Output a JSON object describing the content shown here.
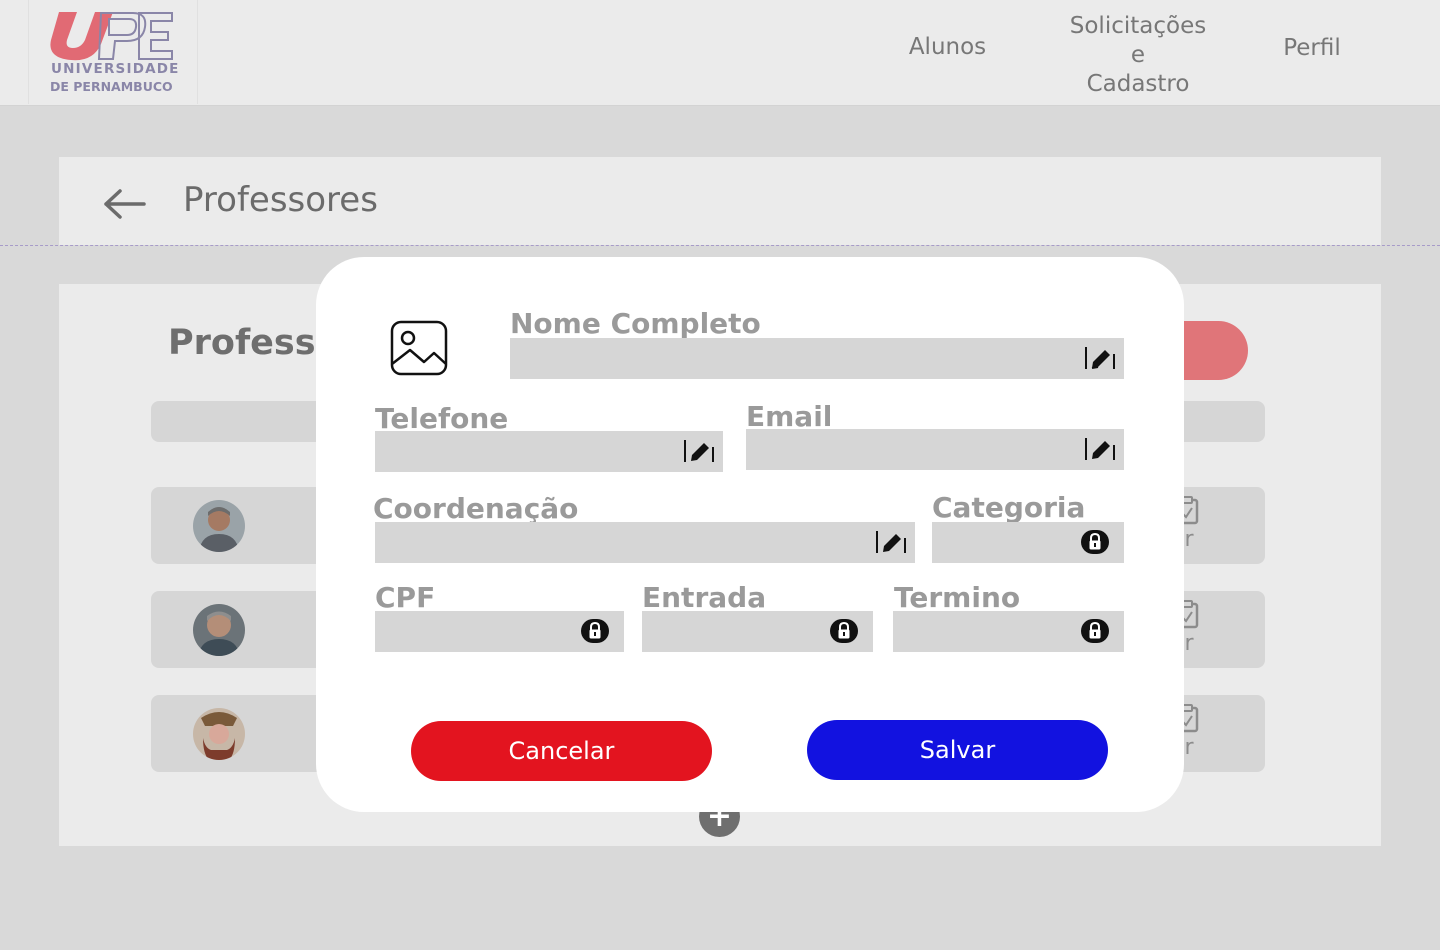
{
  "header": {
    "logo": {
      "mark": "UPE",
      "line1": "UNIVERSIDADE",
      "line2": "DE PERNAMBUCO"
    },
    "nav": {
      "alunos": "Alunos",
      "solicitacoes_line1": "Solicitações",
      "solicitacoes_line2": "e",
      "solicitacoes_line3": "Cadastro",
      "perfil": "Perfil"
    }
  },
  "breadcrumb": {
    "title": "Professores",
    "back_icon": "arrow-left-icon"
  },
  "background": {
    "heading": "Professo",
    "rows": [
      {
        "action": "er"
      },
      {
        "action": "er"
      },
      {
        "action": "er"
      }
    ],
    "add_icon": "plus-icon"
  },
  "modal": {
    "photo_icon": "image-icon",
    "fields": {
      "nome": {
        "label": "Nome Completo",
        "icon": "edit-icon"
      },
      "telefone": {
        "label": "Telefone",
        "icon": "edit-icon"
      },
      "email": {
        "label": "Email",
        "icon": "edit-icon"
      },
      "coordenacao": {
        "label": "Coordenação",
        "icon": "edit-icon"
      },
      "categoria": {
        "label": "Categoria",
        "icon": "lock-icon"
      },
      "cpf": {
        "label": "CPF",
        "icon": "lock-icon"
      },
      "entrada": {
        "label": "Entrada",
        "icon": "lock-icon"
      },
      "termino": {
        "label": "Termino",
        "icon": "lock-icon"
      }
    },
    "buttons": {
      "cancel": "Cancelar",
      "save": "Salvar"
    }
  },
  "colors": {
    "cancel": "#e3141f",
    "save": "#1212e0",
    "add_button": "#e07579",
    "logo_red": "#e16a74",
    "logo_blue": "#8a86a8"
  }
}
